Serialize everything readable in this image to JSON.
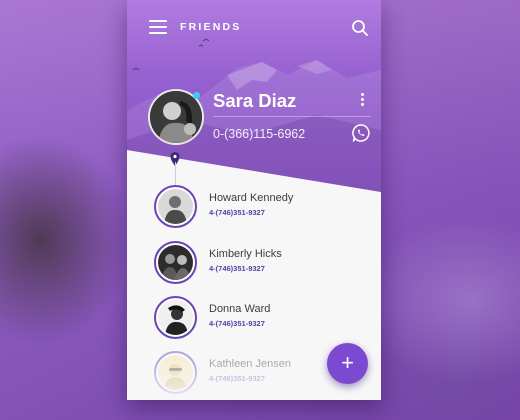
{
  "app": {
    "title": "FRIENDS",
    "icons": {
      "menu": "hamburger-menu-icon",
      "search": "search-icon",
      "more": "more-vertical-icon",
      "whatsapp": "whatsapp-icon",
      "add": "plus-icon"
    },
    "colors": {
      "accent": "#7b4ad0",
      "header": "#9560cf",
      "ring": "#6a44b3",
      "online": "#39d0f2"
    }
  },
  "profile": {
    "name": "Sara Diaz",
    "phone": "0-(366)115-6962",
    "online": true
  },
  "contacts": [
    {
      "name": "Howard Kennedy",
      "phone": "4-(746)351-9327"
    },
    {
      "name": "Kimberly Hicks",
      "phone": "4-(746)351-9327"
    },
    {
      "name": "Donna Ward",
      "phone": "4-(746)351-9327"
    },
    {
      "name": "Kathleen Jensen",
      "phone": "4-(746)351-9327"
    }
  ],
  "fab": {
    "label": "+"
  }
}
